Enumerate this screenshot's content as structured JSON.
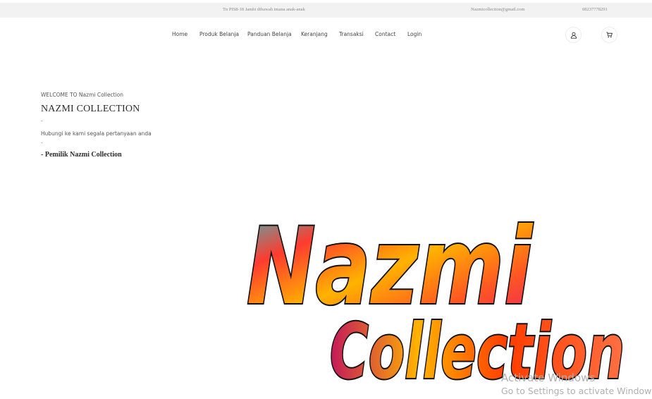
{
  "topbar": {
    "address": "Tn PIS8-18 Jambi dibawah imana anak-anak",
    "email": "Nazmicollection@gmail.com",
    "phone": "08237778291"
  },
  "nav": {
    "items": [
      "Home",
      "Produk Belanja",
      "Panduan Belanja",
      "Keranjang",
      "Transaksi",
      "Contact",
      "Login"
    ]
  },
  "icons": {
    "user": "user-icon",
    "cart": "cart-icon"
  },
  "hero": {
    "welcome": "WELCOME TO Nazmi Collection",
    "title": "NAZMI COLLECTION",
    "dash1": "-",
    "message": "Hubungi ke kami segala pertanyaan anda",
    "dash2": "-",
    "owner": "- Pemilik Nazmi Collection"
  },
  "logo": {
    "line1": "Nazmi",
    "line2": "Collection"
  },
  "watermark": {
    "title": "Activate Windows",
    "subtitle": "Go to Settings to activate Windows."
  }
}
